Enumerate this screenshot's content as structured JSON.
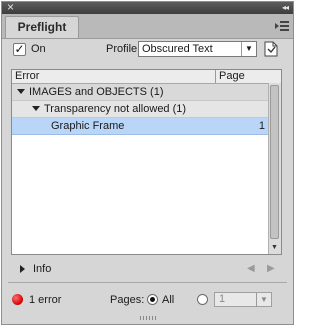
{
  "window": {
    "close_glyph": "×",
    "collapse_glyph": "◂◂"
  },
  "panel": {
    "title": "Preflight",
    "menu_icon": "panel-menu-icon"
  },
  "controls": {
    "on_label": "On",
    "on_checked": true,
    "profile_label": "Profile:",
    "profile_value": "Obscured Text",
    "define_profiles_icon": "define-profiles-icon"
  },
  "list": {
    "columns": {
      "error": "Error",
      "page": "Page"
    },
    "rows": [
      {
        "label": "IMAGES and OBJECTS (1)",
        "page": "",
        "level": 0,
        "expanded": true
      },
      {
        "label": "Transparency not allowed (1)",
        "page": "",
        "level": 1,
        "expanded": true
      },
      {
        "label": "Graphic Frame",
        "page": "1",
        "level": 2,
        "selected": true
      }
    ]
  },
  "info": {
    "label": "Info",
    "prev_glyph": "◀",
    "next_glyph": "▶"
  },
  "status": {
    "error_text": "1 error",
    "error_color": "#d10000",
    "pages_label": "Pages:",
    "all_label": "All",
    "all_selected": true,
    "range_value": "1"
  },
  "colors": {
    "selection": "#b9d6f8",
    "panel_bg": "#d6d6d6"
  }
}
